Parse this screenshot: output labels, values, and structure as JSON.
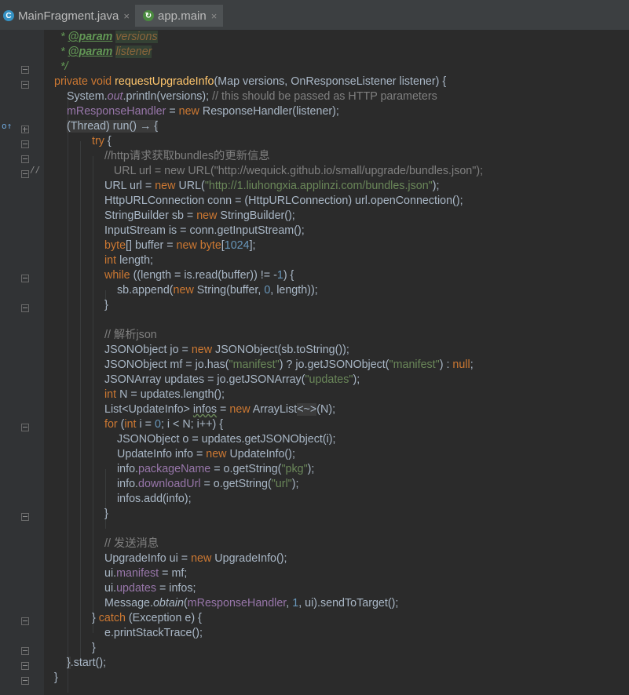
{
  "tabs": [
    {
      "name": "MainFragment.java",
      "icon": "class-c-icon",
      "close": "×",
      "active": false
    },
    {
      "name": "app.main",
      "icon": "module-icon",
      "close": "×",
      "active": true
    }
  ],
  "gutter": {
    "override_marker": "o↑",
    "comment_marker": "//"
  },
  "code": {
    "l1": {
      "star": " * ",
      "tag": "@param",
      "param": "versions"
    },
    "l2": {
      "star": " * ",
      "tag": "@param",
      "param": "listener"
    },
    "l3": {
      "end": " */"
    },
    "l4": {
      "kw1": "private",
      "kw2": "void",
      "method": "requestUpgradeInfo",
      "rest": "(Map versions, OnResponseListener listener) {"
    },
    "l5": {
      "a": "System.",
      "out": "out",
      "b": ".println(versions); ",
      "comment": "// this should be passed as HTTP parameters"
    },
    "l6": {
      "field": "mResponseHandler",
      "a": " = ",
      "kw": "new",
      "b": " ResponseHandler(listener);"
    },
    "l7": {
      "text": "(Thread) run() → {"
    },
    "l8": {
      "kw": "try",
      "b": " {"
    },
    "l9": {
      "comment": "//http请求获取bundles的更新信息"
    },
    "l10": {
      "comment": "   URL url = new URL(\"http://wequick.github.io/small/upgrade/bundles.json\");"
    },
    "l11": {
      "a": "URL url = ",
      "kw": "new",
      "b": " URL(",
      "str": "\"http://1.liuhongxia.applinzi.com/bundles.json\"",
      "c": ");"
    },
    "l12": {
      "a": "HttpURLConnection conn = (HttpURLConnection) url.openConnection();"
    },
    "l13": {
      "a": "StringBuilder sb = ",
      "kw": "new",
      "b": " StringBuilder();"
    },
    "l14": {
      "a": "InputStream is = conn.getInputStream();"
    },
    "l15": {
      "kw1": "byte",
      "a": "[] buffer = ",
      "kw2": "new",
      "kw3": " byte",
      "b": "[",
      "num": "1024",
      "c": "];"
    },
    "l16": {
      "kw": "int",
      "a": " length;"
    },
    "l17": {
      "kw": "while",
      "a": " ((length = is.read(buffer)) != -",
      "num": "1",
      "b": ") {"
    },
    "l18": {
      "a": "sb.append(",
      "kw": "new",
      "b": " String(buffer, ",
      "num": "0",
      "c": ", length));"
    },
    "l19": {
      "a": "}"
    },
    "l21": {
      "comment": "// 解析json"
    },
    "l22": {
      "a": "JSONObject jo = ",
      "kw": "new",
      "b": " JSONObject(sb.toString());"
    },
    "l23": {
      "a": "JSONObject mf = jo.has(",
      "str1": "\"manifest\"",
      "b": ") ? jo.getJSONObject(",
      "str2": "\"manifest\"",
      "c": ") : ",
      "kw": "null",
      "d": ";"
    },
    "l24": {
      "a": "JSONArray updates = jo.getJSONArray(",
      "str": "\"updates\"",
      "b": ");"
    },
    "l25": {
      "kw": "int",
      "a": " N = updates.length();"
    },
    "l26": {
      "a": "List<UpdateInfo> ",
      "var": "infos",
      "b": " = ",
      "kw": "new",
      "c": " ArrayList",
      "diamond": "<~>",
      "d": "(N);"
    },
    "l27": {
      "kw1": "for",
      "a": " (",
      "kw2": "int",
      "b": " i = ",
      "num": "0",
      "c": "; i < N; i++) {"
    },
    "l28": {
      "a": "JSONObject o = updates.getJSONObject(i);"
    },
    "l29": {
      "a": "UpdateInfo info = ",
      "kw": "new",
      "b": " UpdateInfo();"
    },
    "l30": {
      "a": "info.",
      "field": "packageName",
      "b": " = o.getString(",
      "str": "\"pkg\"",
      "c": ");"
    },
    "l31": {
      "a": "info.",
      "field": "downloadUrl",
      "b": " = o.getString(",
      "str": "\"url\"",
      "c": ");"
    },
    "l32": {
      "a": "infos.add(info);"
    },
    "l33": {
      "a": "}"
    },
    "l35": {
      "comment": "// 发送消息"
    },
    "l36": {
      "a": "UpgradeInfo ui = ",
      "kw": "new",
      "b": " UpgradeInfo();"
    },
    "l37": {
      "a": "ui.",
      "field": "manifest",
      "b": " = mf;"
    },
    "l38": {
      "a": "ui.",
      "field": "updates",
      "b": " = infos;"
    },
    "l39": {
      "a": "Message.",
      "method": "obtain",
      "b": "(",
      "field": "mResponseHandler",
      "c": ", ",
      "num": "1",
      "d": ", ui).sendToTarget();"
    },
    "l40": {
      "a": "} ",
      "kw": "catch",
      "b": " (Exception e) {"
    },
    "l41": {
      "a": "e.printStackTrace();"
    },
    "l42": {
      "a": "}"
    },
    "l43": {
      "a": "}",
      "b": ".start();"
    },
    "l44": {
      "a": "}"
    }
  }
}
